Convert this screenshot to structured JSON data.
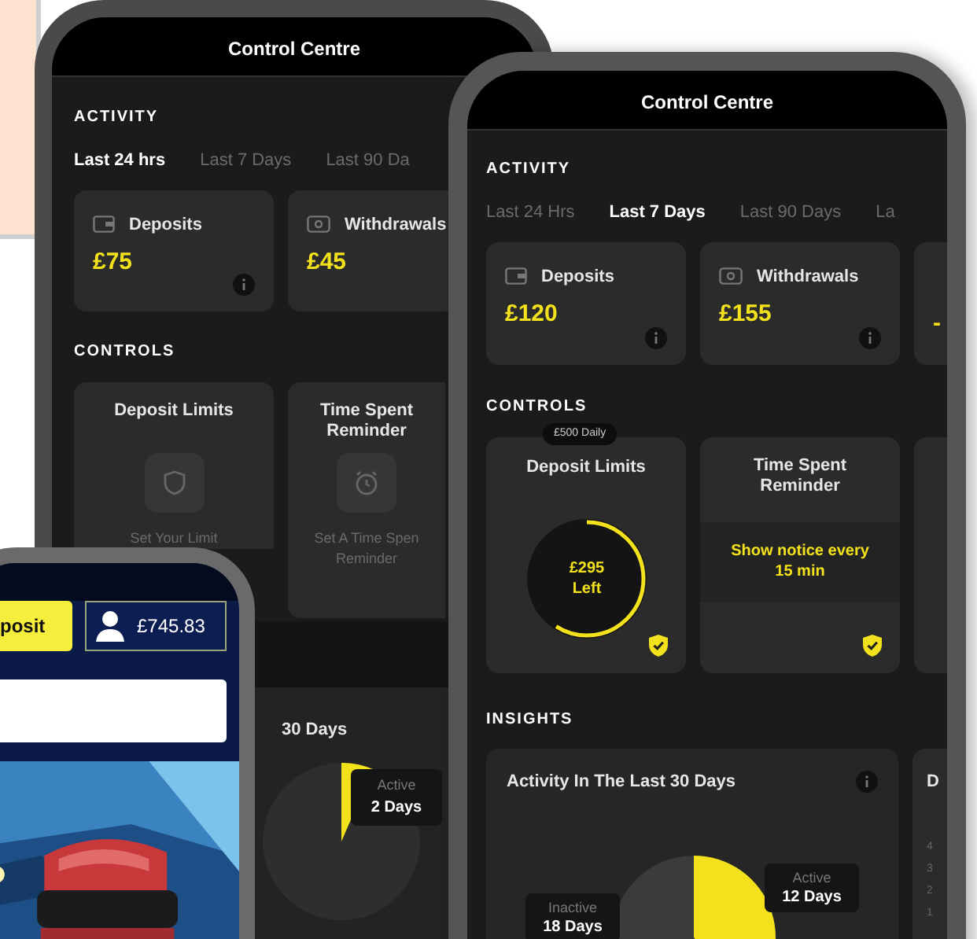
{
  "phone_back": {
    "title": "Control Centre",
    "activity": {
      "heading": "ACTIVITY",
      "tabs": [
        {
          "label": "Last 24 hrs",
          "selected": true
        },
        {
          "label": "Last 7 Days",
          "selected": false
        },
        {
          "label": "Last 90 Da",
          "selected": false
        }
      ],
      "cards": [
        {
          "label": "Deposits",
          "value": "£75"
        },
        {
          "label": "Withdrawals",
          "value": "£45"
        }
      ]
    },
    "controls": {
      "heading": "CONTROLS",
      "cards": [
        {
          "title": "Deposit Limits",
          "hint_lines": [
            "Set Your Limit"
          ]
        },
        {
          "title": "Time Spent Reminder",
          "hint_lines": [
            "Set A Time Spen",
            "Reminder"
          ]
        }
      ]
    },
    "insights": {
      "title": "30 Days",
      "tooltips": [
        {
          "label": "Active",
          "value": "2 Days"
        }
      ]
    }
  },
  "phone_front": {
    "title": "Control Centre",
    "activity": {
      "heading": "ACTIVITY",
      "tabs": [
        {
          "label": "Last 24 Hrs",
          "selected": false
        },
        {
          "label": "Last 7 Days",
          "selected": true
        },
        {
          "label": "Last 90 Days",
          "selected": false
        },
        {
          "label": "La",
          "selected": false
        }
      ],
      "cards": [
        {
          "label": "Deposits",
          "value": "£120"
        },
        {
          "label": "Withdrawals",
          "value": "£155"
        },
        {
          "value": "-"
        }
      ]
    },
    "controls": {
      "heading": "CONTROLS",
      "badge": "£500 Daily",
      "cards": [
        {
          "kind": "limit",
          "title": "Deposit Limits",
          "amount": "£295",
          "caption": "Left",
          "level": 0.59
        },
        {
          "kind": "reminder",
          "title": "Time Spent Reminder",
          "notice": "Show notice every 15 min"
        },
        {
          "kind": "empty"
        }
      ]
    },
    "insights": {
      "heading": "INSIGHTS",
      "cards": [
        {
          "kind": "pie",
          "title": "Activity In The Last 30 Days",
          "chart_data": {
            "type": "pie",
            "categories": [
              "Active",
              "Inactive"
            ],
            "values": [
              40,
              60
            ]
          },
          "value_labels": [
            "12 Days",
            "18 Days"
          ]
        },
        {
          "kind": "bars",
          "title": "D",
          "ticks": [
            "4",
            "3",
            "2",
            "1"
          ]
        }
      ]
    }
  },
  "phone_casino": {
    "deposit_button": "posit",
    "balance": "£745.83"
  }
}
